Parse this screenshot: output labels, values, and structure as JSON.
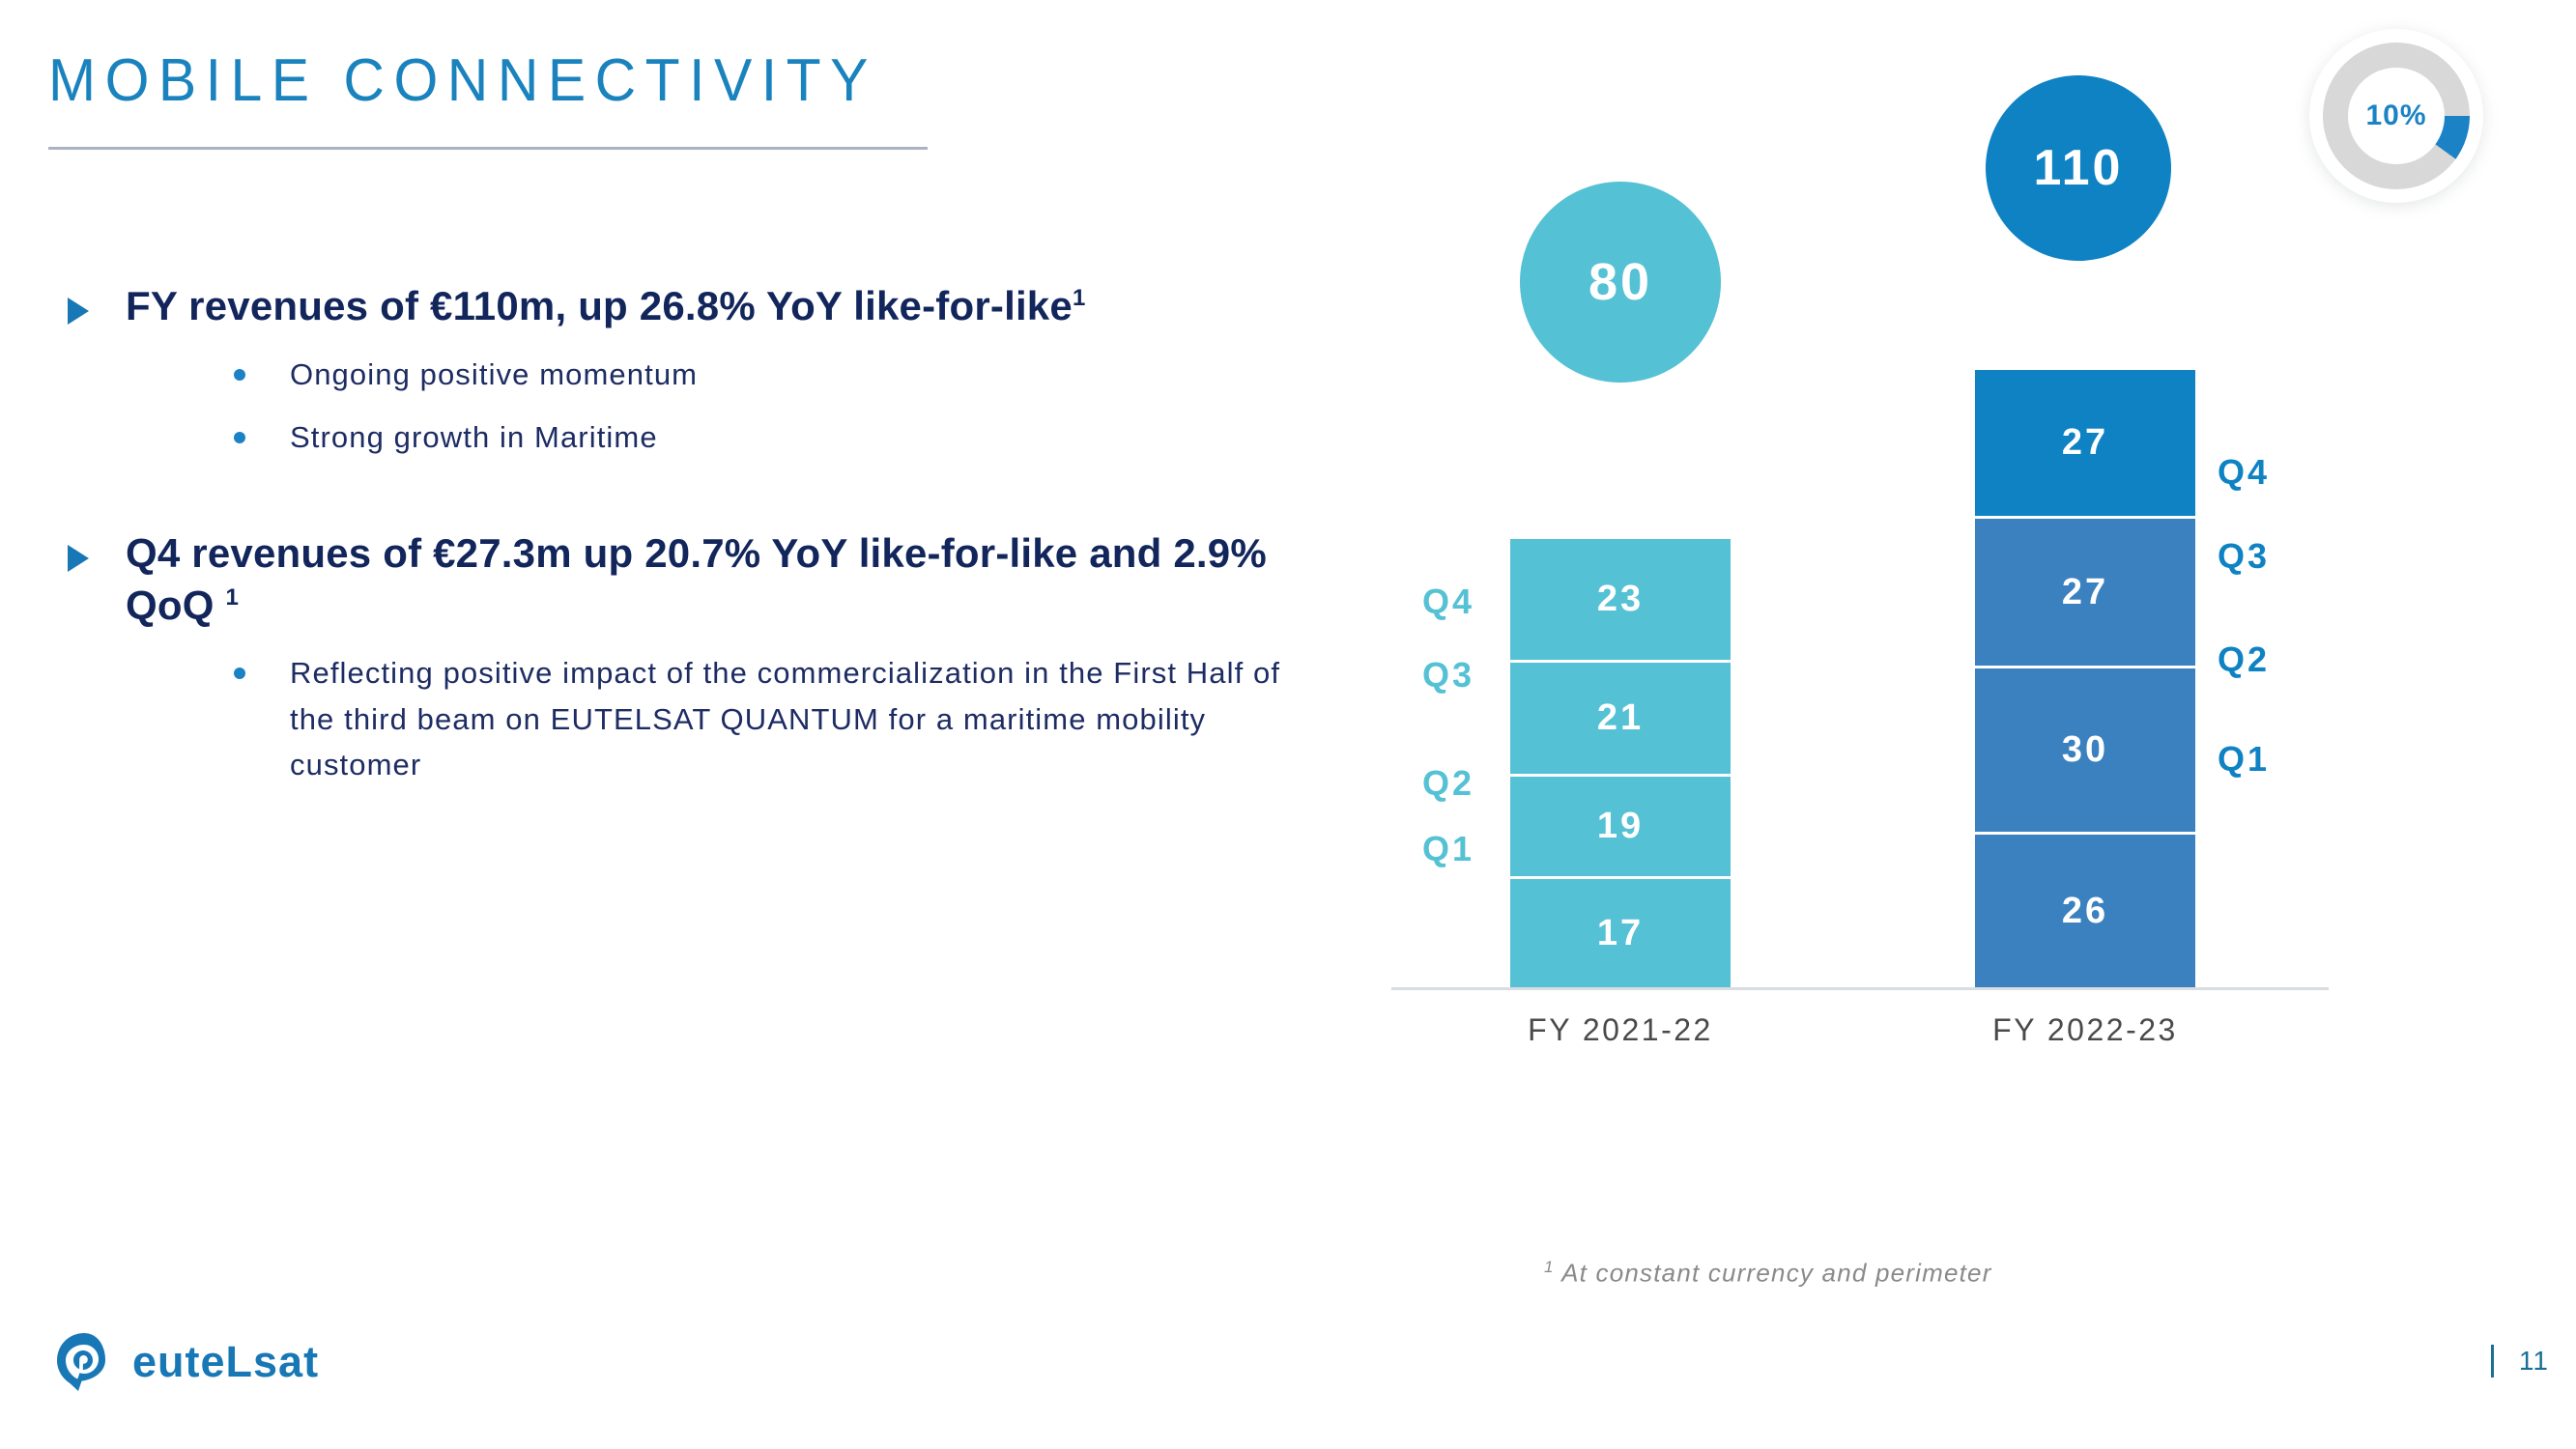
{
  "slide": {
    "title": "MOBILE CONNECTIVITY",
    "page_number": "11",
    "accent_blue": "#1a82bd",
    "dark_navy": "#12265c"
  },
  "bullets": [
    {
      "marker": "triangle-bullet-icon",
      "text": "FY revenues of €110m, up 26.8% YoY like-for-like",
      "superscript": "1",
      "sub": [
        {
          "marker": "dot-bullet-icon",
          "text": "Ongoing positive momentum"
        },
        {
          "marker": "dot-bullet-icon",
          "text": "Strong growth in Maritime"
        }
      ]
    },
    {
      "marker": "triangle-bullet-icon",
      "text": "Q4 revenues of €27.3m up 20.7% YoY like-for-like and 2.9% QoQ ",
      "superscript": "1",
      "sub": [
        {
          "marker": "dot-bullet-icon",
          "text": "Reflecting positive impact of the commercialization in the First Half of the third beam on EUTELSAT QUANTUM for a maritime mobility customer"
        }
      ]
    }
  ],
  "chart_data": {
    "type": "bar",
    "subtype": "stacked-column",
    "title": "",
    "xlabel": "",
    "ylabel": "",
    "grid": false,
    "legend_position": "none",
    "categories": [
      "FY 2021-22",
      "FY 2022-23"
    ],
    "stack_order_bottom_to_top": [
      "Q1",
      "Q2",
      "Q3",
      "Q4"
    ],
    "series": [
      {
        "name": "Q1",
        "values": [
          17,
          26
        ]
      },
      {
        "name": "Q2",
        "values": [
          19,
          30
        ]
      },
      {
        "name": "Q3",
        "values": [
          21,
          27
        ]
      },
      {
        "name": "Q4",
        "values": [
          23,
          27
        ]
      }
    ],
    "totals": [
      80,
      110
    ],
    "colors": {
      "fy2021_22": "#55c1d4",
      "fy2022_23_base": "#3b81bf",
      "fy2022_23_q4": "#0e82c2"
    }
  },
  "bars": {
    "left": {
      "category": "FY 2021-22",
      "total": "80",
      "total_color": "#55c1d4",
      "label_color": "#55c1d4",
      "label_side": "left",
      "segments": [
        {
          "quarter": "Q4",
          "value": "23",
          "color": "#55c1d4"
        },
        {
          "quarter": "Q3",
          "value": "21",
          "color": "#55c1d4"
        },
        {
          "quarter": "Q2",
          "value": "19",
          "color": "#55c1d4"
        },
        {
          "quarter": "Q1",
          "value": "17",
          "color": "#55c1d4"
        }
      ]
    },
    "right": {
      "category": "FY 2022-23",
      "total": "110",
      "total_color": "#0e82c2",
      "label_color": "#0e82c2",
      "label_side": "right",
      "segments": [
        {
          "quarter": "Q4",
          "value": "27",
          "color": "#0e82c2"
        },
        {
          "quarter": "Q3",
          "value": "27",
          "color": "#3b81bf"
        },
        {
          "quarter": "Q2",
          "value": "30",
          "color": "#3b81bf"
        },
        {
          "quarter": "Q1",
          "value": "26",
          "color": "#3b81bf"
        }
      ]
    }
  },
  "donut": {
    "value_label": "10%",
    "percent": 10,
    "arc_color": "#1b82c6",
    "track_color": "#d8d8d8"
  },
  "footnote": {
    "marker": "1",
    "text": "At constant currency and perimeter"
  },
  "footer": {
    "logo_word": "euteLsat",
    "logo_mark": "eutelsat-droplet-logo-icon"
  }
}
